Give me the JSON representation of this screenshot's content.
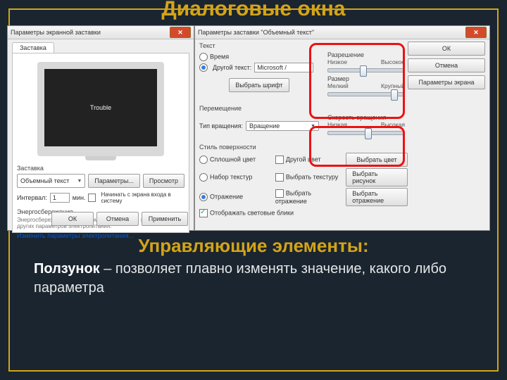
{
  "slide": {
    "title": "Диалоговые окна",
    "subtitle": "Управляющие элементы:",
    "desc_bold": "Ползунок",
    "desc_rest": " – позволяет плавно изменять значение, какого либо параметра"
  },
  "d1": {
    "title": "Параметры экранной заставки",
    "tab": "Заставка",
    "preview_text": "Trouble",
    "group": "Заставка",
    "screensaver_sel": "Объемный текст",
    "btn_params": "Параметры...",
    "btn_preview": "Просмотр",
    "lbl_interval": "Интервал:",
    "interval_val": "1",
    "lbl_min": "мин.",
    "chk_login": "Начинать с экрана входа в систему",
    "grp_power": "Энергосбережение",
    "power_text": "Энергосбережение за счет изменения яркости экрана или других параметров электропитания.",
    "link_power": "Изменить параметры электропитания...",
    "btn_ok": "ОК",
    "btn_cancel": "Отмена",
    "btn_apply": "Применить"
  },
  "d2": {
    "title": "Параметры заставки \"Объемный текст\"",
    "grp_text": "Текст",
    "rad_time": "Время",
    "rad_other": "Другой текст:",
    "other_val": "Microsoft /",
    "btn_font": "Выбрать шрифт",
    "grp_motion": "Перемещение",
    "lbl_rottype": "Тип вращения:",
    "rot_sel": "Вращение",
    "grp_res": "Разрешение",
    "res_lo": "Низкое",
    "res_hi": "Высокое",
    "grp_size": "Размер",
    "size_lo": "Мелкий",
    "size_hi": "Крупный",
    "grp_speed": "Скорость вращения",
    "speed_lo": "Низкая",
    "speed_hi": "Высокая",
    "grp_surface": "Стиль поверхности",
    "rad_solid": "Сплошной цвет",
    "chk_othercolor": "Другой цвет",
    "btn_color": "Выбрать цвет",
    "rad_texture": "Набор текстур",
    "chk_texsel": "Выбрать текстуру",
    "btn_texture": "Выбрать рисунок",
    "rad_reflect": "Отражение",
    "chk_reflsel": "Выбрать отражение",
    "btn_reflect": "Выбрать отражение",
    "chk_highlights": "Отображать световые блики",
    "btn_ok": "ОК",
    "btn_cancel": "Отмена",
    "btn_display": "Параметры экрана"
  }
}
